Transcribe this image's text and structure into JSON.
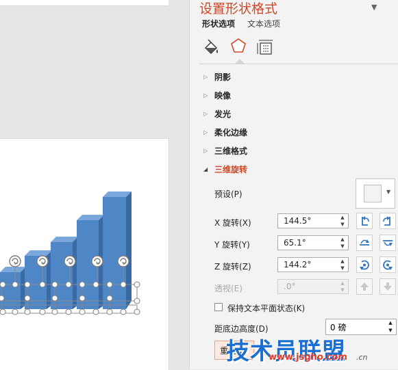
{
  "pane": {
    "title": "设置形状格式",
    "menu_caret": "▼",
    "tabs": [
      "形状选项",
      "文本选项"
    ],
    "sections": [
      {
        "label": "阴影",
        "expanded": false
      },
      {
        "label": "映像",
        "expanded": false
      },
      {
        "label": "发光",
        "expanded": false
      },
      {
        "label": "柔化边缘",
        "expanded": false
      },
      {
        "label": "三维格式",
        "expanded": false
      },
      {
        "label": "三维旋转",
        "expanded": true
      }
    ],
    "rotation": {
      "preset_label": "预设(P)",
      "x_label": "X 旋转(X)",
      "x_value": "144.5°",
      "y_label": "Y 旋转(Y)",
      "y_value": "65.1°",
      "z_label": "Z 旋转(Z)",
      "z_value": "144.2°",
      "perspective_label": "透视(E)",
      "perspective_value": ".0°",
      "keep_text_flat_label": "保持文本平面状态(K)",
      "keep_text_flat_checked": false,
      "distance_label": "距底边高度(D)",
      "distance_value": "0 磅",
      "reset_label": "重置(R)"
    }
  },
  "watermark": {
    "name": "技术员联盟",
    "url": "www.jsgho.com",
    "suffix": ".cn"
  },
  "colors": {
    "accent": "#d24726",
    "bar_front": "#4f86c6",
    "bar_top": "#7aa7dc",
    "bar_side": "#3a6aa4"
  }
}
